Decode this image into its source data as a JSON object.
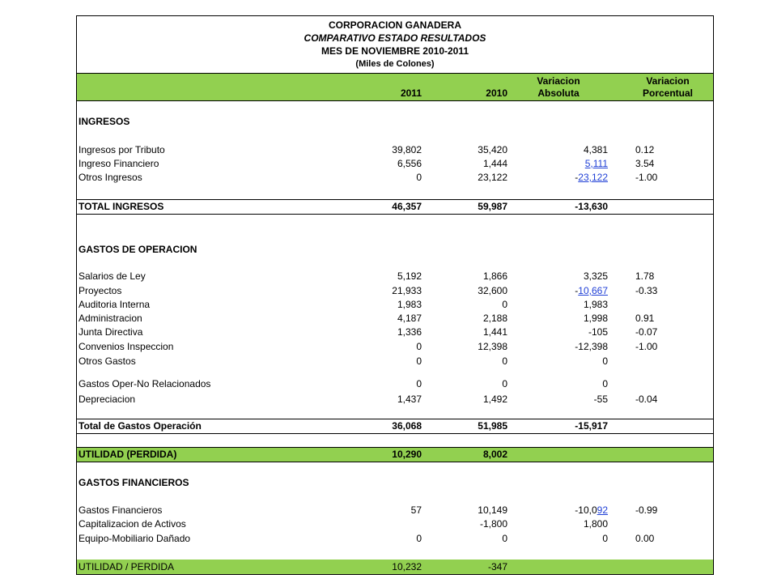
{
  "header": {
    "line1": "CORPORACION GANADERA",
    "line2": "COMPARATIVO ESTADO RESULTADOS",
    "line3": "MES DE NOVIEMBRE 2010-2011",
    "line4": "(Miles de Colones)"
  },
  "columns": {
    "y2011": "2011",
    "y2010": "2010",
    "abs_top": "Variacion",
    "abs_bottom": "Absoluta",
    "pct_top": "Variacion",
    "pct_bottom": "Porcentual"
  },
  "colors": {
    "green": "#92d050",
    "link": "#1f3fd6"
  },
  "ingresos": {
    "title": "INGRESOS",
    "rows": [
      {
        "label": "Ingresos por Tributo",
        "v2011": "39,802",
        "v2010": "35,420",
        "abs": "4,381",
        "pct": "0.12"
      },
      {
        "label": "Ingreso Financiero",
        "v2011": "6,556",
        "v2010": "1,444",
        "abs_pre": "",
        "abs_link": "5,111",
        "pct": "3.54"
      },
      {
        "label": "Otros Ingresos",
        "v2011": "0",
        "v2010": "23,122",
        "abs_pre": "-",
        "abs_link": "23,122",
        "pct": "-1.00"
      }
    ],
    "total": {
      "label": "TOTAL INGRESOS",
      "v2011": "46,357",
      "v2010": "59,987",
      "abs": "-13,630"
    }
  },
  "gastos": {
    "title": "GASTOS DE OPERACION",
    "rows": [
      {
        "label": "Salarios de Ley",
        "v2011": "5,192",
        "v2010": "1,866",
        "abs": "3,325",
        "pct": "1.78"
      },
      {
        "label": "Proyectos",
        "v2011": "21,933",
        "v2010": "32,600",
        "abs_pre": "-",
        "abs_link": "10,667",
        "pct": "-0.33"
      },
      {
        "label": "Auditoria Interna",
        "v2011": "1,983",
        "v2010": "0",
        "abs": "1,983",
        "pct": ""
      },
      {
        "label": "Administracion",
        "v2011": "4,187",
        "v2010": "2,188",
        "abs": "1,998",
        "pct": "0.91"
      },
      {
        "label": "Junta Directiva",
        "v2011": "1,336",
        "v2010": "1,441",
        "abs": "-105",
        "pct": "-0.07"
      },
      {
        "label": "Convenios Inspeccion",
        "v2011": "0",
        "v2010": "12,398",
        "abs": "-12,398",
        "pct": "-1.00"
      },
      {
        "label": "Otros Gastos",
        "v2011": "0",
        "v2010": "0",
        "abs": "0",
        "pct": ""
      },
      {
        "label": "Gastos Oper-No Relacionados",
        "v2011": "0",
        "v2010": "0",
        "abs": "0",
        "pct": ""
      },
      {
        "label": "Depreciacion",
        "v2011": "1,437",
        "v2010": "1,492",
        "abs": "-55",
        "pct": "-0.04"
      }
    ],
    "total": {
      "label": "Total de Gastos Operación",
      "v2011": "36,068",
      "v2010": "51,985",
      "abs": "-15,917"
    }
  },
  "utilidad": {
    "label": "UTILIDAD (PERDIDA)",
    "v2011": "10,290",
    "v2010": "8,002"
  },
  "financieros": {
    "title": "GASTOS FINANCIEROS",
    "rows": [
      {
        "label": "Gastos Financieros",
        "v2011": "57",
        "v2010": "10,149",
        "abs_pre": "-10,0",
        "abs_link": "92",
        "pct": "-0.99"
      },
      {
        "label": "Capitalizacion de Activos",
        "v2011": "",
        "v2010": "-1,800",
        "abs": "1,800",
        "pct": ""
      },
      {
        "label": "Equipo-Mobiliario Dañado",
        "v2011": "0",
        "v2010": "0",
        "abs": "0",
        "pct": "0.00"
      }
    ]
  },
  "final": {
    "label": "UTILIDAD  / PERDIDA",
    "v2011": "10,232",
    "v2010": "-347"
  }
}
